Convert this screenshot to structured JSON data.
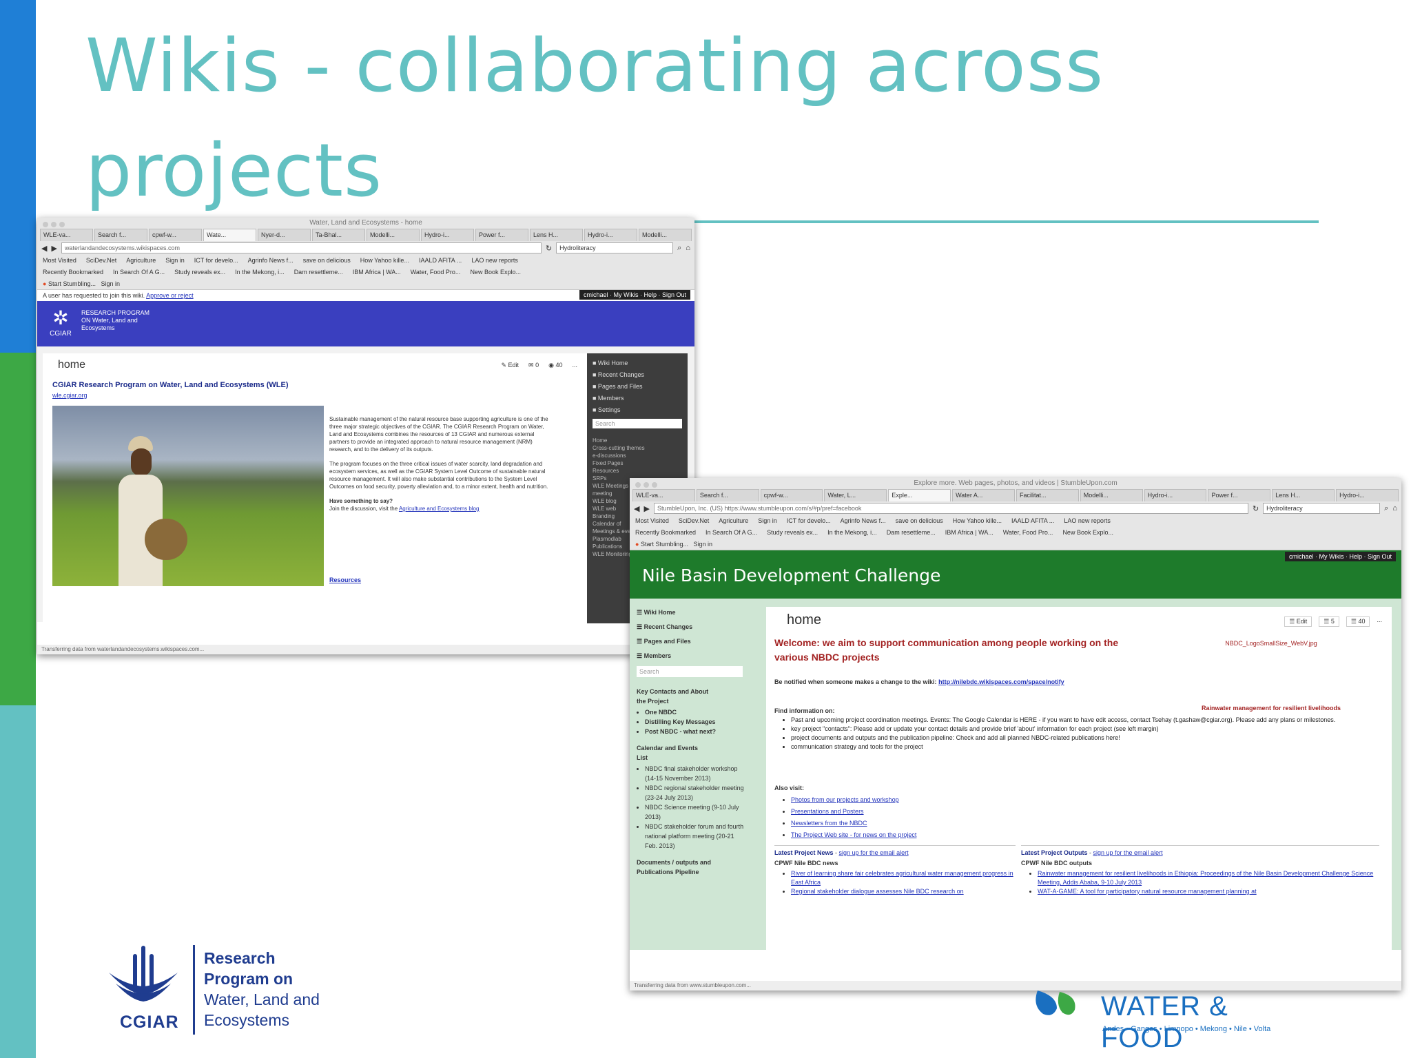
{
  "slide": {
    "title": "Wikis  - collaborating across projects",
    "colors": {
      "accent": "#63c1c2",
      "bar_top": "#1f7fd6",
      "bar_mid": "#3da845",
      "bar_bottom": "#63c1c2"
    }
  },
  "wle_window": {
    "window_title": "Water, Land and Ecosystems - home",
    "tabs": [
      "WLE-va...",
      "Search f...",
      "cpwf-w...",
      "Wate...",
      "Nyer-d...",
      "Ta-Bhal...",
      "Modelli...",
      "Hydro-i...",
      "Power f...",
      "Lens H...",
      "Hydro-i...",
      "Modelli..."
    ],
    "url": "waterlandandecosystems.wikispaces.com",
    "search_value": "Hydroliteracy",
    "bookmarks_1": [
      "Most Visited",
      "SciDev.Net",
      "Agriculture",
      "Sign in",
      "ICT for develo...",
      "Agrinfo News f...",
      "save on delicious",
      "How Yahoo kille...",
      "IAALD AFITA ...",
      "LAO new reports"
    ],
    "bookmarks_2": [
      "Recently Bookmarked",
      "In Search Of A G...",
      "Study reveals ex...",
      "In the Mekong, i...",
      "Dam resettleme...",
      "IBM Africa | WA...",
      "Water, Food Pro...",
      "New Book Explo..."
    ],
    "stumble_label": "Start Stumbling...",
    "stumble_signin": "Sign in",
    "notice": "A user has requested to join this wiki.",
    "notice_link": "Approve or reject",
    "user_links": "cmichael · My Wikis · Help · Sign Out",
    "logo_text": "RESEARCH PROGRAM ON Water, Land and Ecosystems",
    "logo_org": "CGIAR",
    "page_title": "home",
    "actions": {
      "edit": "Edit",
      "comments": "0",
      "views": "40",
      "more": "..."
    },
    "heading": "CGIAR Research Program on Water, Land and Ecosystems (WLE)",
    "heading_link": "wle.cgiar.org",
    "para1": "Sustainable management of the natural resource base supporting agriculture is one of the three major strategic objectives of the CGIAR. The CGIAR Research Program on Water, Land and Ecosystems combines the resources of 13 CGIAR and numerous external partners to provide an integrated approach to natural resource management (NRM) research, and to the delivery of its outputs.",
    "para2": "The program focuses on the three critical issues of water scarcity, land degradation and ecosystem services, as well as the CGIAR System Level Outcome of sustainable natural resource management. It will also make substantial contributions to the System Level Outcomes on food security, poverty alleviation and, to a minor extent, health and nutrition.",
    "question": "Have something to say?",
    "discussion": "Join the discussion, visit the",
    "discussion_link": "Agriculture and Ecosystems blog",
    "resources": "Resources",
    "sidebar_items": [
      "Wiki Home",
      "Recent Changes",
      "Pages and Files",
      "Members",
      "Settings"
    ],
    "sidebar_search": "Search",
    "sidebar_links": [
      "Home",
      "Cross-cutting themes",
      "e-discussions",
      "Fixed Pages",
      "Resources",
      "SRPs",
      "WLE Meetings",
      "meeting",
      "WLE blog",
      "WLE web",
      "Branding",
      "Calendar of",
      "Meetings & events",
      "Plasmodlab",
      "Publications",
      "WLE Monitoring"
    ],
    "status": "Transferring data from waterlandandecosystems.wikispaces.com..."
  },
  "nbdc_window": {
    "window_title": "Explore more. Web pages, photos, and videos | StumbleUpon.com",
    "tabs": [
      "WLE-va...",
      "Search f...",
      "cpwf-w...",
      "Water, L...",
      "Exple...",
      "Water A...",
      "Facilitat...",
      "Modelli...",
      "Hydro-i...",
      "Power f...",
      "Lens H...",
      "Hydro-i..."
    ],
    "url": "StumbleUpon, Inc. (US) https://www.stumbleupon.com/s/#p/pref=facebook",
    "search_value": "Hydroliteracy",
    "bookmarks_1": [
      "Most Visited",
      "SciDev.Net",
      "Agriculture",
      "Sign in",
      "ICT for develo...",
      "Agrinfo News f...",
      "save on delicious",
      "How Yahoo kille...",
      "IAALD AFITA ...",
      "LAO new reports"
    ],
    "bookmarks_2": [
      "Recently Bookmarked",
      "In Search Of A G...",
      "Study reveals ex...",
      "In the Mekong, i...",
      "Dam resettleme...",
      "IBM Africa | WA...",
      "Water, Food Pro...",
      "New Book Explo..."
    ],
    "stumble_label": "Start Stumbling...",
    "stumble_signin": "Sign in",
    "user_links": "cmichael · My Wikis · Help · Sign Out",
    "site_title": "Nile Basin Development Challenge",
    "sidebar_items": [
      "Wiki Home",
      "Recent Changes",
      "Pages and Files",
      "Members"
    ],
    "sidebar_search": "Search",
    "sidebar_head1": "Key Contacts and About the Project",
    "sidebar_list1": [
      "One NBDC",
      "Distilling Key Messages",
      "Post NBDC - what next?"
    ],
    "sidebar_head2": "Calendar and Events List",
    "sidebar_list2": [
      "NBDC final stakeholder workshop (14-15 November 2013)",
      "NBDC regional stakeholder meeting (23-24 July 2013)",
      "NBDC Science meeting (9-10 July 2013)",
      "NBDC stakeholder forum and fourth national platform meeting (20-21 Feb. 2013)"
    ],
    "sidebar_head3": "Documents / outputs and Publications Pipeline",
    "page_title": "home",
    "actions": {
      "edit": "Edit",
      "comments": "5",
      "views": "40",
      "more": "..."
    },
    "welcome": "Welcome: we aim to support communication among people working on the various NBDC projects",
    "logo_caption": "NBDC_LogoSmallSize_WebV.jpg",
    "notify_text": "Be notified when someone makes a change to the wiki:",
    "notify_link": "http://nilebdc.wikispaces.com/space/notify",
    "rainwater": "Rainwater management for resilient livelihoods",
    "find_head": "Find information on:",
    "find_items": [
      "Past and upcoming project coordination meetings. Events: The Google Calendar is HERE - if you want to have edit access, contact Tsehay (t.gashaw@cgiar.org). Please add any plans or milestones.",
      "key project \"contacts\": Please add or update your contact details and provide brief 'about' information for each project (see left margin)",
      "project documents and outputs and the publication pipeline: Check and add all planned NBDC-related publications here!",
      "communication strategy and tools for the project"
    ],
    "also_head": "Also visit:",
    "also_items": [
      "Photos from our projects and workshop",
      "Presentations and Posters",
      "Newsletters from the NBDC",
      "The Project Web site - for news on the project"
    ],
    "news_head": "Latest Project News",
    "news_signup": "sign up for the email alert",
    "news_sub": "CPWF Nile BDC news",
    "news_items": [
      "River of learning share fair celebrates agricultural water management progress in East Africa",
      "Regional stakeholder dialogue assesses Nile BDC research on"
    ],
    "outputs_head": "Latest Project Outputs",
    "outputs_signup": "sign up for the email alert",
    "outputs_sub": "CPWF Nile BDC outputs",
    "outputs_items": [
      "Rainwater management for resilient livelihoods in Ethiopia: Proceedings of the Nile Basin Development Challenge Science Meeting, Addis Ababa, 9-10 July 2013",
      "WAT-A-GAME: A tool for participatory natural resource management planning at"
    ],
    "status": "Transferring data from www.stumbleupon.com..."
  },
  "footer": {
    "cgiar_lines": [
      "Research",
      "Program on",
      "Water, Land and",
      "Ecosystems"
    ],
    "cgiar_org": "CGIAR",
    "wf_title": "WATER & FOOD",
    "wf_basins": "Andes • Ganges • Limpopo • Mekong • Nile • Volta"
  }
}
